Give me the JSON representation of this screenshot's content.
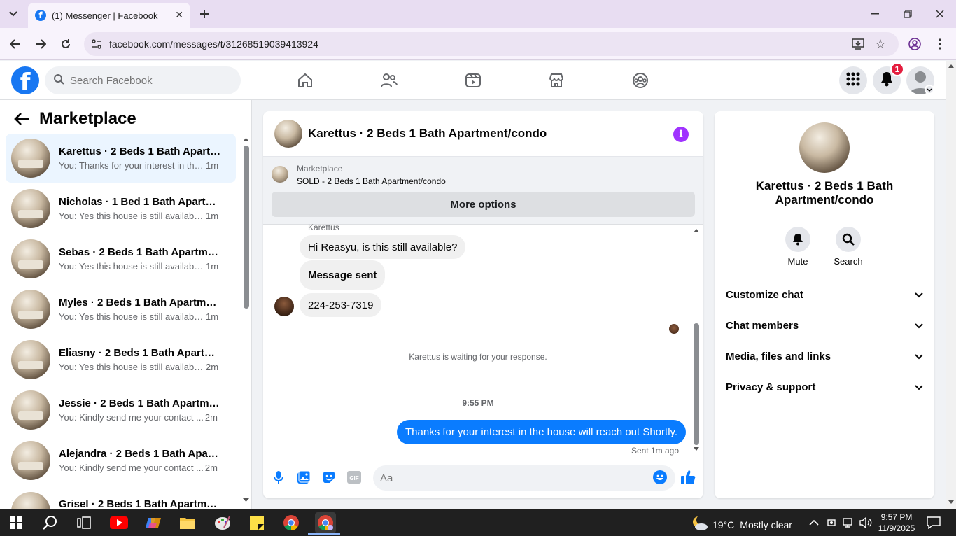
{
  "browser": {
    "tab_title": "(1) Messenger | Facebook",
    "url": "facebook.com/messages/t/31268519039413924"
  },
  "fb": {
    "search_placeholder": "Search Facebook",
    "notification_count": "1",
    "brand_color": "#1877f2"
  },
  "left": {
    "title": "Marketplace",
    "conversations": [
      {
        "name": "Karettus · 2 Beds 1 Bath Apartm...",
        "snippet": "You: Thanks for your interest in the...",
        "time": "1m"
      },
      {
        "name": "Nicholas · 1 Bed 1 Bath Apartme...",
        "snippet": "You: Yes this house is still available ...",
        "time": "1m"
      },
      {
        "name": "Sebas · 2 Beds 1 Bath Apartment...",
        "snippet": "You: Yes this house is still available ...",
        "time": "1m"
      },
      {
        "name": "Myles · 2 Beds 1 Bath Apartment...",
        "snippet": "You: Yes this house is still available ...",
        "time": "1m"
      },
      {
        "name": "Eliasny · 2 Beds 1 Bath Apartmen...",
        "snippet": "You: Yes this house is still available ...",
        "time": "2m"
      },
      {
        "name": "Jessie · 2 Beds 1 Bath Apartment...",
        "snippet": "You: Kindly send me your contact ...",
        "time": "2m"
      },
      {
        "name": "Alejandra · 2 Beds 1 Bath Apart...",
        "snippet": "You: Kindly send me your contact ...",
        "time": "2m"
      },
      {
        "name": "Grisel · 2 Beds 1 Bath Apartment...",
        "snippet": "",
        "time": ""
      }
    ]
  },
  "chat": {
    "title": "Karettus · 2 Beds 1 Bath Apartment/condo",
    "marketplace_label": "Marketplace",
    "listing_status": "SOLD - 2 Beds 1 Bath Apartment/condo",
    "more_options": "More options",
    "sender_name": "Karettus",
    "messages_in": [
      "Hi Reasyu, is this still available?",
      "Message sent",
      "224-253-7319"
    ],
    "waiting": "Karettus is waiting for your response.",
    "time_separator": "9:55 PM",
    "message_out": "Thanks for your interest in the house will reach out Shortly.",
    "sent_status": "Sent 1m ago",
    "input_placeholder": "Aa",
    "accent_color": "#0a7cff"
  },
  "details": {
    "name": "Karettus · 2 Beds 1 Bath Apartment/condo",
    "mute_label": "Mute",
    "search_label": "Search",
    "sections": [
      "Customize chat",
      "Chat members",
      "Media, files and links",
      "Privacy & support"
    ]
  },
  "taskbar": {
    "temperature": "19°C",
    "weather": "Mostly clear",
    "time": "9:57 PM",
    "date": "11/9/2025"
  }
}
